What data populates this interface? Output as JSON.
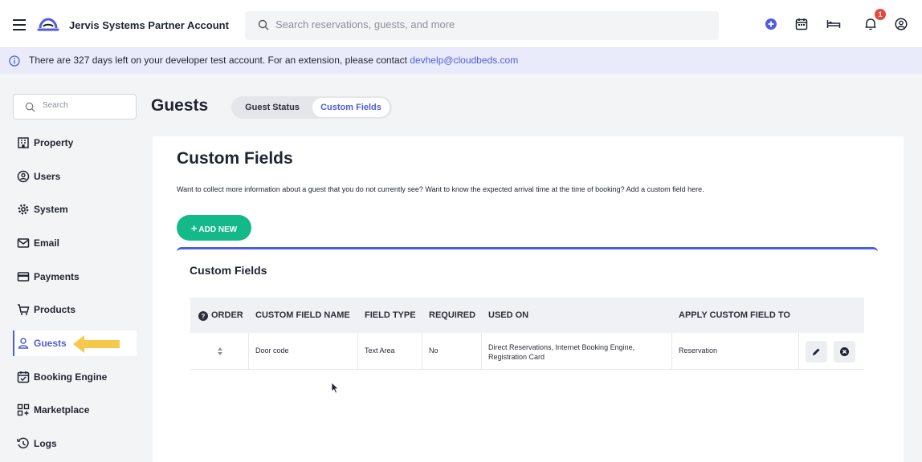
{
  "topbar": {
    "account_name": "Jervis Systems Partner Account",
    "search_placeholder": "Search reservations, guests, and more",
    "notification_count": "1",
    "icons": [
      "menu-icon",
      "cloudbeds-logo",
      "search-icon",
      "add-circle-icon",
      "calendar-icon",
      "bed-icon",
      "bell-icon",
      "user-circle-icon"
    ]
  },
  "banner": {
    "text": "There are 327 days left on your developer test account. For an extension, please contact ",
    "link": "devhelp@cloudbeds.com"
  },
  "sidebar": {
    "search_placeholder": "Search",
    "items": [
      {
        "label": "Property",
        "icon": "building-icon"
      },
      {
        "label": "Users",
        "icon": "user-icon"
      },
      {
        "label": "System",
        "icon": "gear-icon"
      },
      {
        "label": "Email",
        "icon": "envelope-icon"
      },
      {
        "label": "Payments",
        "icon": "credit-card-icon"
      },
      {
        "label": "Products",
        "icon": "cart-icon"
      },
      {
        "label": "Guests",
        "icon": "guest-icon",
        "active": true
      },
      {
        "label": "Booking Engine",
        "icon": "calendar-check-icon"
      },
      {
        "label": "Marketplace",
        "icon": "apps-icon"
      },
      {
        "label": "Logs",
        "icon": "history-icon"
      }
    ]
  },
  "page": {
    "title": "Guests",
    "tabs": [
      "Guest Status",
      "Custom Fields"
    ],
    "active_tab": "Custom Fields"
  },
  "content": {
    "title": "Custom Fields",
    "description": "Want to collect more information about a guest that you do not currently see? Want to know the expected arrival time at the time of booking? Add a custom field here.",
    "add_button": "ADD NEW",
    "panel_title": "Custom Fields",
    "columns": [
      "ORDER",
      "CUSTOM FIELD NAME",
      "FIELD TYPE",
      "REQUIRED",
      "USED ON",
      "APPLY CUSTOM FIELD TO"
    ],
    "rows": [
      {
        "name": "Door code",
        "field_type": "Text Area",
        "required": "No",
        "used_on": "Direct Reservations, Internet Booking Engine, Registration Card",
        "apply_to": "Reservation"
      }
    ]
  },
  "colors": {
    "accent": "#4e5ed8",
    "add_button": "#14b98a",
    "banner_bg": "#e9ebfb",
    "notification": "#e5483f",
    "pointer_arrow": "#f6c94a"
  }
}
